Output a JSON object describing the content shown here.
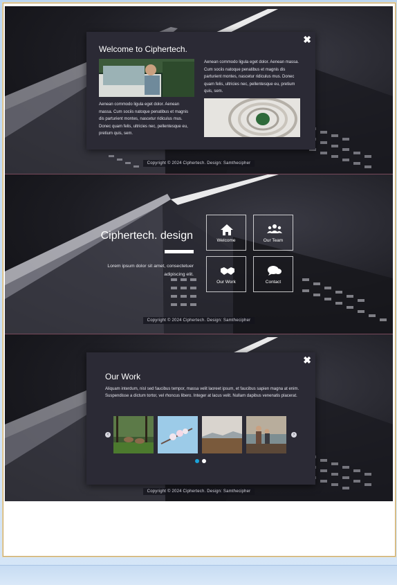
{
  "section_welcome": {
    "title": "Welcome to Ciphertech.",
    "close_icon": "x-close-icon",
    "para_right": "Aenean commodo ligula eget dolor. Aenean massa. Cum sociis natoque penatibus et magnis dis parturient montes, nascetur ridiculus mus. Donec quam felis, ultricies nec, pellentesque eu, pretium quis, sem.",
    "para_left": "Aenean commodo ligula eget dolor. Aenean massa. Cum sociis natoque penatibus et magnis dis parturient montes, nascetur ridiculus mus. Donec quam felis, ultricies nec, pellentesque eu, pretium quis, sem.",
    "footer": "Copyright © 2024 Ciphertech. Design: Samthecipher"
  },
  "section_home": {
    "brand": "Ciphertech. design",
    "tagline_line1": "Lorem ipsum dolor sit amet, consectetuer",
    "tagline_line2": "adipiscing elit.",
    "tiles": [
      {
        "label": "Welcome",
        "icon": "home-icon"
      },
      {
        "label": "Our Team",
        "icon": "users-icon"
      },
      {
        "label": "Our Work",
        "icon": "handshake-icon"
      },
      {
        "label": "Contact",
        "icon": "chat-bubble-icon"
      }
    ],
    "footer": "Copyright © 2024 Ciphertech. Design: Samthecipher"
  },
  "section_work": {
    "title": "Our Work",
    "close_icon": "x-close-icon",
    "para": "Aliquam interdum, nisl sed faucibus tempor, massa velit laoreet ipsum, et faucibus sapien magna at enim. Suspendisse a dictum tortor, vel rhoncus libero. Integer at lacus velit. Nullam dapibus venenatis placerat.",
    "prev_arrow": "‹",
    "next_arrow": "›",
    "carousel_pages": 2,
    "active_page": 1,
    "footer": "Copyright © 2024 Ciphertech. Design: Samthecipher"
  },
  "colors": {
    "modal_bg": "#2b2a35",
    "dot_active": "#1aa3d9",
    "dot_inactive": "#ffffff"
  }
}
